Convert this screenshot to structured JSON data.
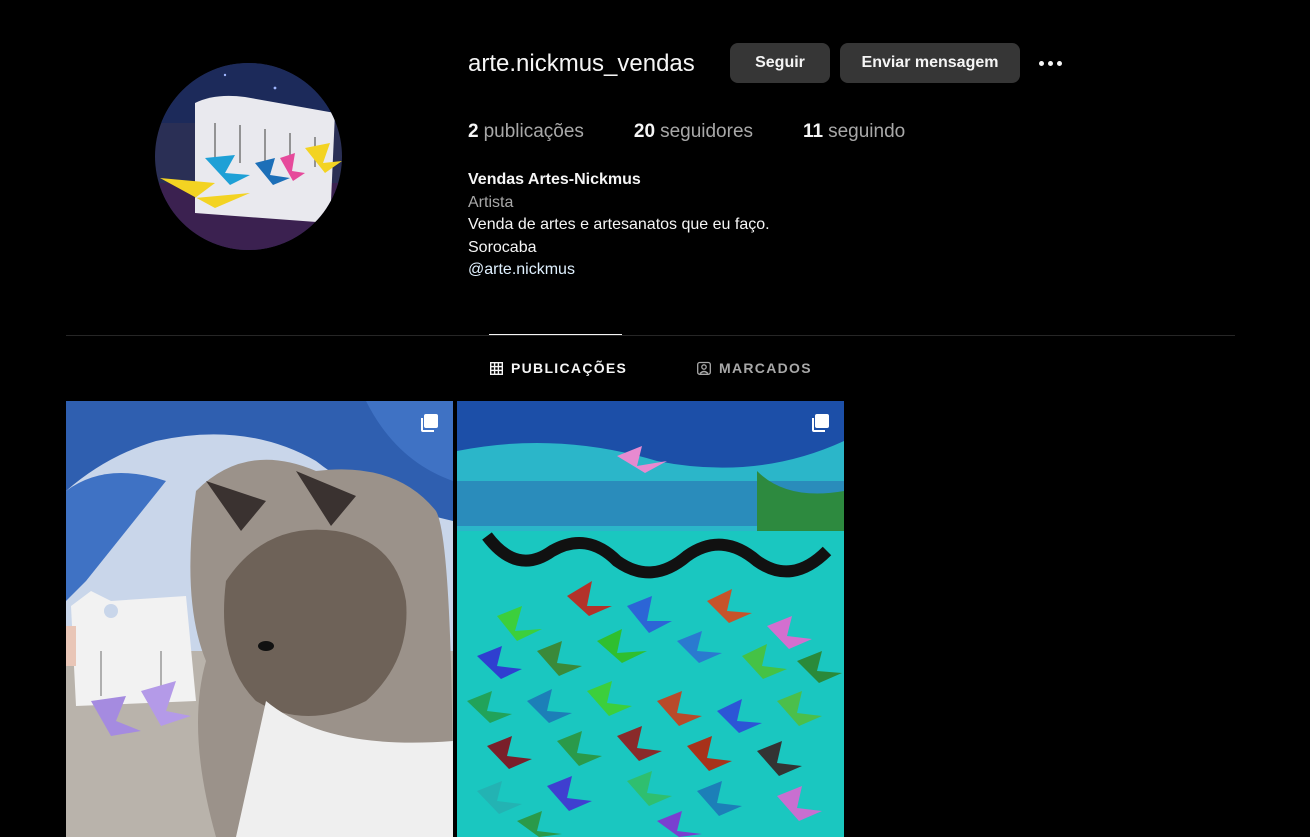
{
  "profile": {
    "username": "arte.nickmus_vendas",
    "follow_label": "Seguir",
    "message_label": "Enviar mensagem",
    "more_icon": "more-horizontal-icon"
  },
  "stats": {
    "posts_count": "2",
    "posts_label": "publicações",
    "followers_count": "20",
    "followers_label": "seguidores",
    "following_count": "11",
    "following_label": "seguindo"
  },
  "bio": {
    "name": "Vendas Artes-Nickmus",
    "category": "Artista",
    "description": "Venda de artes e artesanatos que eu faço.",
    "location": "Sorocaba",
    "handle": "@arte.nickmus"
  },
  "tabs": [
    {
      "label": "PUBLICAÇÕES",
      "icon": "grid-icon",
      "active": true
    },
    {
      "label": "MARCADOS",
      "icon": "tagged-icon",
      "active": false
    }
  ],
  "posts": [
    {
      "icon": "carousel-icon"
    },
    {
      "icon": "carousel-icon"
    }
  ],
  "colors": {
    "background": "#000000",
    "button": "#363636",
    "text_primary": "#f5f5f5",
    "text_secondary": "#a8a8a8",
    "divider": "#262626"
  }
}
